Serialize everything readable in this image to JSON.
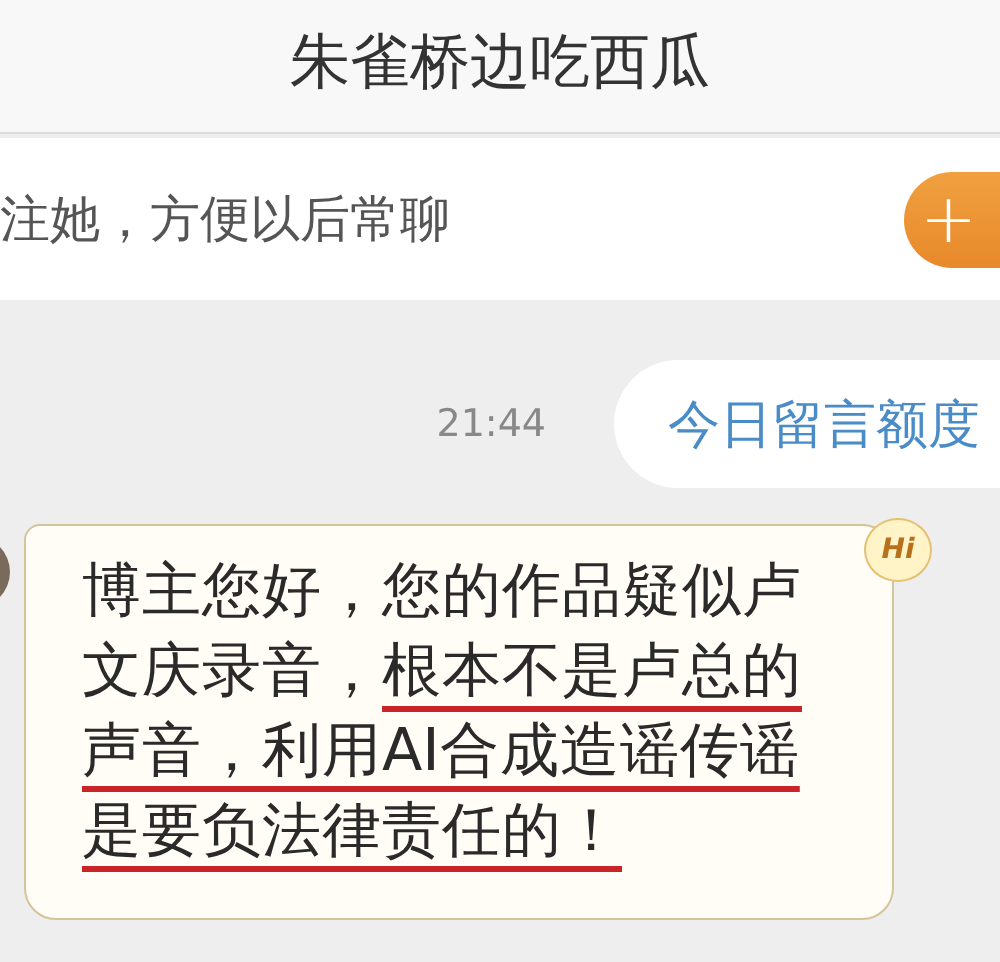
{
  "header": {
    "title": "朱雀桥边吃西瓜"
  },
  "follow_bar": {
    "text": "注她，方便以后常聊",
    "button": "+"
  },
  "messages": [
    {
      "kind": "time",
      "text": "21:44"
    },
    {
      "kind": "outgoing",
      "text": "今日留言额度"
    },
    {
      "kind": "incoming",
      "badge": "Hi",
      "segments": [
        {
          "text": "博主您好，您的作品疑似卢文庆录音，",
          "underlined": false
        },
        {
          "text": "根本不是卢总的声音，利用AI合成造谣传谣是要负法律责任的！",
          "underlined": true
        }
      ]
    }
  ]
}
